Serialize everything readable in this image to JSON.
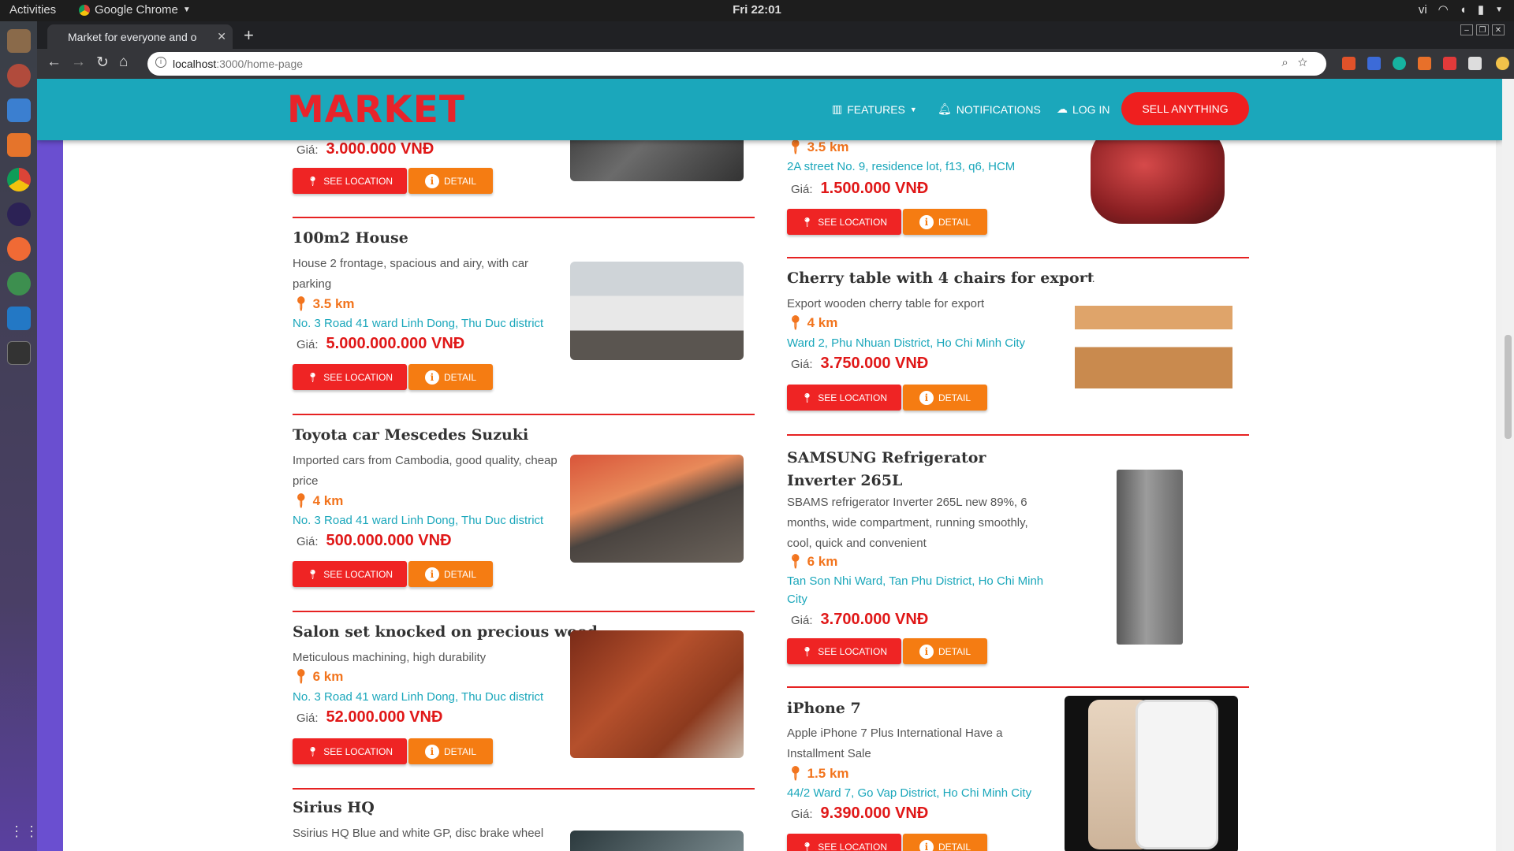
{
  "system": {
    "activities": "Activities",
    "app_name": "Google Chrome",
    "clock": "Fri 22:01",
    "lang": "vi"
  },
  "browser": {
    "tab_title": "Market for everyone and o",
    "url_host": "localhost",
    "url_path": ":3000/home-page"
  },
  "header": {
    "logo": "MARKET",
    "features": "FEATURES",
    "notifications": "NOTIFICATIONS",
    "login": "LOG IN",
    "sell": "SELL ANYTHING"
  },
  "labels": {
    "price": "Giá:",
    "see_location": "SEE LOCATION",
    "detail": "DETAIL"
  },
  "left_items": [
    {
      "title": "",
      "desc": "",
      "distance": "",
      "address": "",
      "price": "3.000.000 VNĐ"
    },
    {
      "title": "100m2 House",
      "desc": "House 2 frontage, spacious and airy, with car parking",
      "distance": "3.5 km",
      "address": "No. 3 Road 41 ward Linh Dong, Thu Duc district",
      "price": "5.000.000.000 VNĐ"
    },
    {
      "title": "Toyota car Mescedes Suzuki",
      "desc": "Imported cars from Cambodia, good quality, cheap price",
      "distance": "4 km",
      "address": "No. 3 Road 41 ward Linh Dong, Thu Duc district",
      "price": "500.000.000 VNĐ"
    },
    {
      "title": "Salon set knocked on precious wood",
      "desc": "Meticulous machining, high durability",
      "distance": "6 km",
      "address": "No. 3 Road 41 ward Linh Dong, Thu Duc district",
      "price": "52.000.000 VNĐ"
    },
    {
      "title": "Sirius HQ",
      "desc": "Ssirius HQ Blue and white GP, disc brake wheel",
      "distance": "",
      "address": "",
      "price": ""
    }
  ],
  "right_items": [
    {
      "title": "",
      "desc": "",
      "distance": "3.5 km",
      "address": "2A street No. 9, residence lot, f13, q6, HCM",
      "price": "1.500.000 VNĐ"
    },
    {
      "title": "Cherry table with 4 chairs for export",
      "desc": "Export wooden cherry table for export",
      "distance": "4 km",
      "address": "Ward 2, Phu Nhuan District, Ho Chi Minh City",
      "price": "3.750.000 VNĐ"
    },
    {
      "title": "SAMSUNG Refrigerator Inverter 265L",
      "desc": "SBAMS refrigerator Inverter 265L new 89%, 6 months, wide compartment, running smoothly, cool, quick and convenient",
      "distance": "6 km",
      "address": "Tan Son Nhi Ward, Tan Phu District, Ho Chi Minh City",
      "price": "3.700.000 VNĐ"
    },
    {
      "title": "iPhone 7",
      "desc": "Apple iPhone 7 Plus International Have a Installment Sale",
      "distance": "1.5 km",
      "address": "44/2 Ward 7, Go Vap District, Ho Chi Minh City",
      "price": "9.390.000 VNĐ"
    }
  ],
  "colors": {
    "brand": "#1ba7bb",
    "accent": "#e8232a",
    "price": "#e01818",
    "distance": "#f2741d"
  }
}
